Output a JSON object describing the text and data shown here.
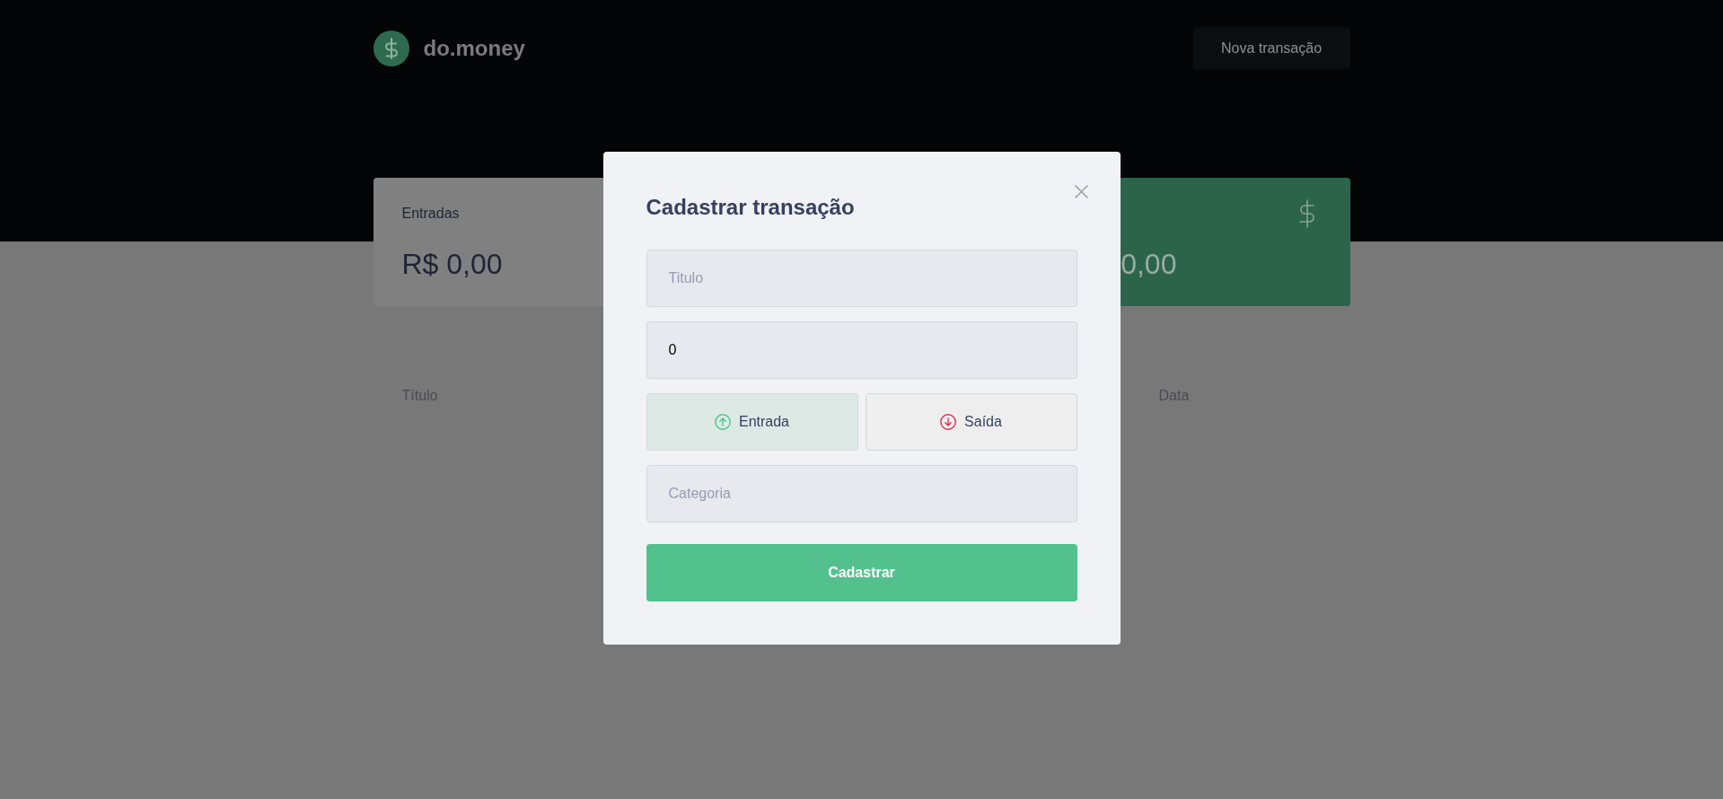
{
  "header": {
    "brand": "do.money",
    "new_transaction_button": "Nova transação"
  },
  "summary_cards": [
    {
      "kind": "income",
      "label": "Entradas",
      "value": "R$ 0,00"
    },
    {
      "kind": "total",
      "value": "0,00"
    }
  ],
  "table": {
    "columns": [
      "Título",
      "Data"
    ]
  },
  "modal": {
    "title": "Cadastrar transação",
    "title_field": {
      "placeholder": "Titulo"
    },
    "amount_field": {
      "value": "0"
    },
    "type_options": [
      {
        "kind": "deposit",
        "label": "Entrada",
        "selected": true
      },
      {
        "kind": "withdraw",
        "label": "Saída",
        "selected": false
      }
    ],
    "category_field": {
      "placeholder": "Categoria"
    },
    "submit_button": "Cadastrar"
  }
}
